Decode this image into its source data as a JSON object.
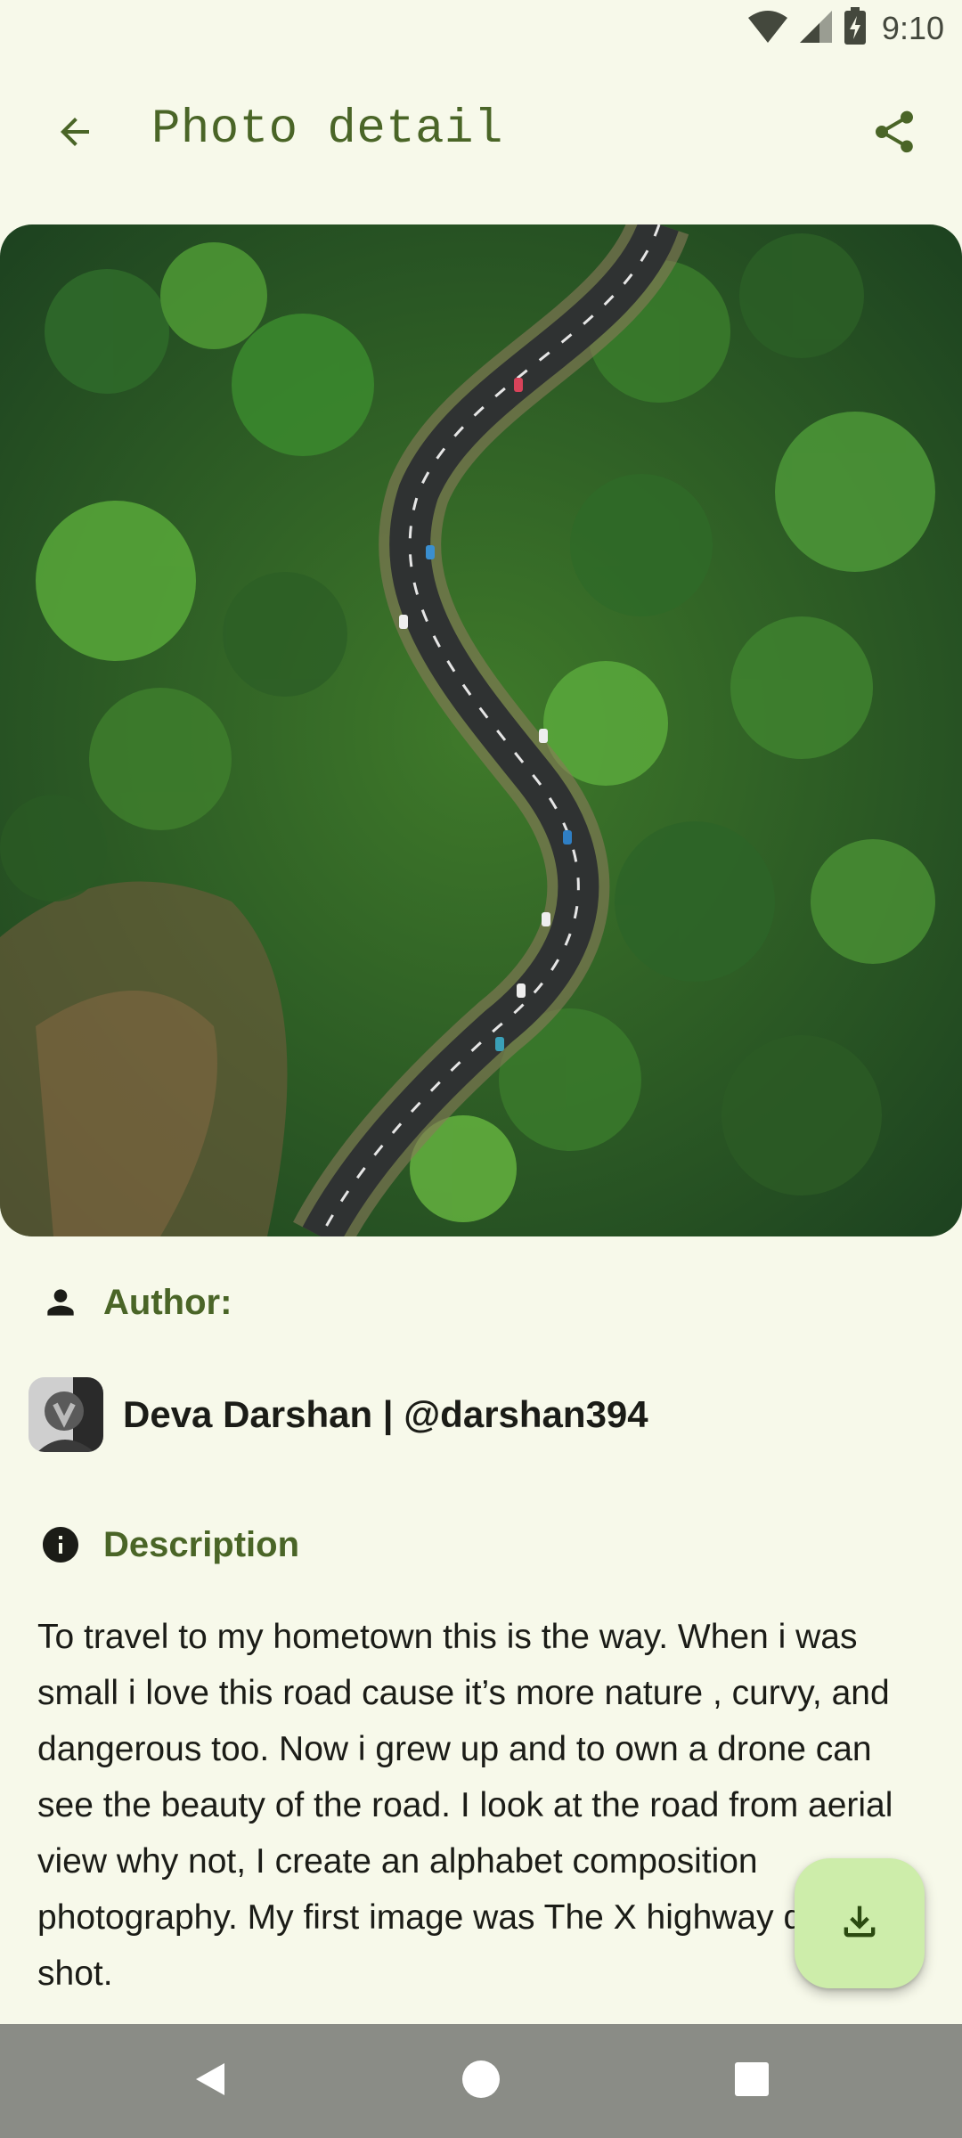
{
  "status_bar": {
    "time": "9:10",
    "icons": [
      "wifi-icon",
      "signal-icon",
      "battery-charging-icon"
    ]
  },
  "app_bar": {
    "title": "Photo detail",
    "back_icon": "arrow-back-icon",
    "share_icon": "share-icon"
  },
  "photo": {
    "subject": "aerial view of a winding road through forest"
  },
  "author_section": {
    "label": "Author:",
    "icon": "person-icon",
    "name": "Deva Darshan | @darshan394"
  },
  "description_section": {
    "label": "Description",
    "icon": "info-icon",
    "text": "To travel to my hometown this is the way. When i was small i love this road cause it’s more nature , curvy, and dangerous too. Now i grew up and to own a drone can see the beauty of the road. I look at the road from aerial view why not, I create an alphabet composition  photography. My first image was The X highway drone shot."
  },
  "fab": {
    "icon": "download-icon"
  },
  "nav_bar": {
    "icons": [
      "back-triangle-icon",
      "home-circle-icon",
      "recents-square-icon"
    ]
  },
  "colors": {
    "background": "#f7f9ea",
    "accent": "#4a6527",
    "fab": "#cdedaa",
    "nav_bar": "#8a8c86"
  }
}
